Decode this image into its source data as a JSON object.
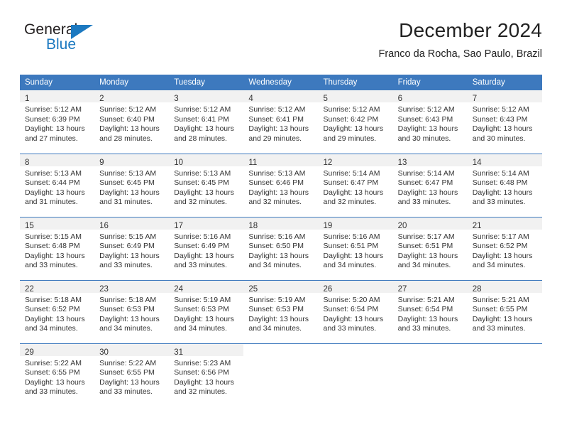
{
  "brand": {
    "name_part1": "General",
    "name_part2": "Blue",
    "accent_color": "#1c79c0",
    "text_color": "#231f20"
  },
  "header": {
    "title": "December 2024",
    "subtitle": "Franco da Rocha, Sao Paulo, Brazil",
    "header_bg_color": "#3d79be",
    "daynum_bg_color": "#f1f1f1"
  },
  "weekdays": [
    "Sunday",
    "Monday",
    "Tuesday",
    "Wednesday",
    "Thursday",
    "Friday",
    "Saturday"
  ],
  "weeks": [
    [
      {
        "day": "1",
        "sunrise": "Sunrise: 5:12 AM",
        "sunset": "Sunset: 6:39 PM",
        "daylight1": "Daylight: 13 hours",
        "daylight2": "and 27 minutes."
      },
      {
        "day": "2",
        "sunrise": "Sunrise: 5:12 AM",
        "sunset": "Sunset: 6:40 PM",
        "daylight1": "Daylight: 13 hours",
        "daylight2": "and 28 minutes."
      },
      {
        "day": "3",
        "sunrise": "Sunrise: 5:12 AM",
        "sunset": "Sunset: 6:41 PM",
        "daylight1": "Daylight: 13 hours",
        "daylight2": "and 28 minutes."
      },
      {
        "day": "4",
        "sunrise": "Sunrise: 5:12 AM",
        "sunset": "Sunset: 6:41 PM",
        "daylight1": "Daylight: 13 hours",
        "daylight2": "and 29 minutes."
      },
      {
        "day": "5",
        "sunrise": "Sunrise: 5:12 AM",
        "sunset": "Sunset: 6:42 PM",
        "daylight1": "Daylight: 13 hours",
        "daylight2": "and 29 minutes."
      },
      {
        "day": "6",
        "sunrise": "Sunrise: 5:12 AM",
        "sunset": "Sunset: 6:43 PM",
        "daylight1": "Daylight: 13 hours",
        "daylight2": "and 30 minutes."
      },
      {
        "day": "7",
        "sunrise": "Sunrise: 5:12 AM",
        "sunset": "Sunset: 6:43 PM",
        "daylight1": "Daylight: 13 hours",
        "daylight2": "and 30 minutes."
      }
    ],
    [
      {
        "day": "8",
        "sunrise": "Sunrise: 5:13 AM",
        "sunset": "Sunset: 6:44 PM",
        "daylight1": "Daylight: 13 hours",
        "daylight2": "and 31 minutes."
      },
      {
        "day": "9",
        "sunrise": "Sunrise: 5:13 AM",
        "sunset": "Sunset: 6:45 PM",
        "daylight1": "Daylight: 13 hours",
        "daylight2": "and 31 minutes."
      },
      {
        "day": "10",
        "sunrise": "Sunrise: 5:13 AM",
        "sunset": "Sunset: 6:45 PM",
        "daylight1": "Daylight: 13 hours",
        "daylight2": "and 32 minutes."
      },
      {
        "day": "11",
        "sunrise": "Sunrise: 5:13 AM",
        "sunset": "Sunset: 6:46 PM",
        "daylight1": "Daylight: 13 hours",
        "daylight2": "and 32 minutes."
      },
      {
        "day": "12",
        "sunrise": "Sunrise: 5:14 AM",
        "sunset": "Sunset: 6:47 PM",
        "daylight1": "Daylight: 13 hours",
        "daylight2": "and 32 minutes."
      },
      {
        "day": "13",
        "sunrise": "Sunrise: 5:14 AM",
        "sunset": "Sunset: 6:47 PM",
        "daylight1": "Daylight: 13 hours",
        "daylight2": "and 33 minutes."
      },
      {
        "day": "14",
        "sunrise": "Sunrise: 5:14 AM",
        "sunset": "Sunset: 6:48 PM",
        "daylight1": "Daylight: 13 hours",
        "daylight2": "and 33 minutes."
      }
    ],
    [
      {
        "day": "15",
        "sunrise": "Sunrise: 5:15 AM",
        "sunset": "Sunset: 6:48 PM",
        "daylight1": "Daylight: 13 hours",
        "daylight2": "and 33 minutes."
      },
      {
        "day": "16",
        "sunrise": "Sunrise: 5:15 AM",
        "sunset": "Sunset: 6:49 PM",
        "daylight1": "Daylight: 13 hours",
        "daylight2": "and 33 minutes."
      },
      {
        "day": "17",
        "sunrise": "Sunrise: 5:16 AM",
        "sunset": "Sunset: 6:49 PM",
        "daylight1": "Daylight: 13 hours",
        "daylight2": "and 33 minutes."
      },
      {
        "day": "18",
        "sunrise": "Sunrise: 5:16 AM",
        "sunset": "Sunset: 6:50 PM",
        "daylight1": "Daylight: 13 hours",
        "daylight2": "and 34 minutes."
      },
      {
        "day": "19",
        "sunrise": "Sunrise: 5:16 AM",
        "sunset": "Sunset: 6:51 PM",
        "daylight1": "Daylight: 13 hours",
        "daylight2": "and 34 minutes."
      },
      {
        "day": "20",
        "sunrise": "Sunrise: 5:17 AM",
        "sunset": "Sunset: 6:51 PM",
        "daylight1": "Daylight: 13 hours",
        "daylight2": "and 34 minutes."
      },
      {
        "day": "21",
        "sunrise": "Sunrise: 5:17 AM",
        "sunset": "Sunset: 6:52 PM",
        "daylight1": "Daylight: 13 hours",
        "daylight2": "and 34 minutes."
      }
    ],
    [
      {
        "day": "22",
        "sunrise": "Sunrise: 5:18 AM",
        "sunset": "Sunset: 6:52 PM",
        "daylight1": "Daylight: 13 hours",
        "daylight2": "and 34 minutes."
      },
      {
        "day": "23",
        "sunrise": "Sunrise: 5:18 AM",
        "sunset": "Sunset: 6:53 PM",
        "daylight1": "Daylight: 13 hours",
        "daylight2": "and 34 minutes."
      },
      {
        "day": "24",
        "sunrise": "Sunrise: 5:19 AM",
        "sunset": "Sunset: 6:53 PM",
        "daylight1": "Daylight: 13 hours",
        "daylight2": "and 34 minutes."
      },
      {
        "day": "25",
        "sunrise": "Sunrise: 5:19 AM",
        "sunset": "Sunset: 6:53 PM",
        "daylight1": "Daylight: 13 hours",
        "daylight2": "and 34 minutes."
      },
      {
        "day": "26",
        "sunrise": "Sunrise: 5:20 AM",
        "sunset": "Sunset: 6:54 PM",
        "daylight1": "Daylight: 13 hours",
        "daylight2": "and 33 minutes."
      },
      {
        "day": "27",
        "sunrise": "Sunrise: 5:21 AM",
        "sunset": "Sunset: 6:54 PM",
        "daylight1": "Daylight: 13 hours",
        "daylight2": "and 33 minutes."
      },
      {
        "day": "28",
        "sunrise": "Sunrise: 5:21 AM",
        "sunset": "Sunset: 6:55 PM",
        "daylight1": "Daylight: 13 hours",
        "daylight2": "and 33 minutes."
      }
    ],
    [
      {
        "day": "29",
        "sunrise": "Sunrise: 5:22 AM",
        "sunset": "Sunset: 6:55 PM",
        "daylight1": "Daylight: 13 hours",
        "daylight2": "and 33 minutes."
      },
      {
        "day": "30",
        "sunrise": "Sunrise: 5:22 AM",
        "sunset": "Sunset: 6:55 PM",
        "daylight1": "Daylight: 13 hours",
        "daylight2": "and 33 minutes."
      },
      {
        "day": "31",
        "sunrise": "Sunrise: 5:23 AM",
        "sunset": "Sunset: 6:56 PM",
        "daylight1": "Daylight: 13 hours",
        "daylight2": "and 32 minutes."
      },
      {
        "day": "",
        "sunrise": "",
        "sunset": "",
        "daylight1": "",
        "daylight2": ""
      },
      {
        "day": "",
        "sunrise": "",
        "sunset": "",
        "daylight1": "",
        "daylight2": ""
      },
      {
        "day": "",
        "sunrise": "",
        "sunset": "",
        "daylight1": "",
        "daylight2": ""
      },
      {
        "day": "",
        "sunrise": "",
        "sunset": "",
        "daylight1": "",
        "daylight2": ""
      }
    ]
  ]
}
